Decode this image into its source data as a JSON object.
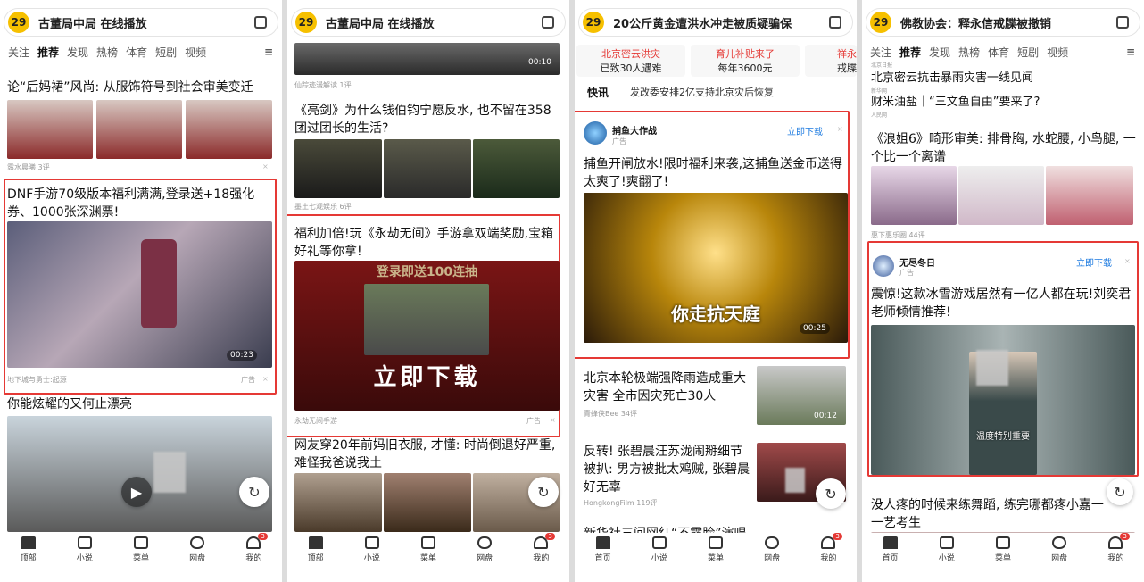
{
  "screens": [
    {
      "temp": "29",
      "hot": "古董局中局 在线播放",
      "tabs": [
        "关注",
        "推荐",
        "发现",
        "热榜",
        "体育",
        "短剧",
        "视频"
      ],
      "item1_title": "论“后妈裙”风尚: 从服饰符号到社会审美变迁",
      "item1_meta": "露水晨曦  3评",
      "ad_title": "DNF手游70级版本福利满满,登录送+18强化券、1000张深渊票!",
      "ad_source": "地下城与勇士:起源",
      "ad_label": "广告",
      "ad_duration": "00:23",
      "item3_title": "你能炫耀的又何止漂亮"
    },
    {
      "temp": "29",
      "hot": "古董局中局 在线播放",
      "top_duration": "00:10",
      "top_meta": "仙踪迹漫解读  1评",
      "item1_title": "《亮剑》为什么钱伯钧宁愿反水, 也不留在358团过团长的生活?",
      "item1_meta": "墨土七观娱乐  6评",
      "ad_title": "福利加倍!玩《永劫无间》手游拿双端奖励,宝箱好礼等你拿!",
      "ad_banner": "立即下载",
      "ad_top_text": "登录即送100连抽",
      "ad_source": "永劫无间手游",
      "ad_label": "广告",
      "item3_title": "网友穿20年前妈旧衣服, 才懂: 时尚倒退好严重, 难怪我爸说我土"
    },
    {
      "temp": "29",
      "hot": "20公斤黄金遭洪水冲走被质疑骗保",
      "cards": [
        {
          "a": "北京密云洪灾",
          "b": "已致30人遇难"
        },
        {
          "a": "育儿补贴来了",
          "b": "每年3600元"
        },
        {
          "a": "祥永",
          "b": "戒牒"
        }
      ],
      "flash_tag": "快讯",
      "flash_text": "发改委安排2亿支持北京灾后恢复",
      "ad_name": "捕鱼大作战",
      "ad_label": "广告",
      "ad_download": "立即下载",
      "ad_title": "捕鱼开闸放水!限时福利来袭,这捕鱼送金币送得太爽了!爽翻了!",
      "ad_banner": "你走抗天庭",
      "ad_duration": "00:25",
      "item2_title": "北京本轮极端强降雨造成重大灾害 全市因灾死亡30人",
      "item2_meta": "青蜂侠Bee  34评",
      "item2_duration": "00:12",
      "item3_title": "反转! 张碧晨汪苏泷闹掰细节被扒: 男方被批太鸡贼, 张碧晨好无辜",
      "item3_meta": "HongkongFilm  119评",
      "item4_title": "新华社三问网红“不露脸”演唱"
    },
    {
      "temp": "29",
      "hot": "佛教协会：释永信戒牒被撤销",
      "tabs": [
        "关注",
        "推荐",
        "发现",
        "热榜",
        "体育",
        "短剧",
        "视频"
      ],
      "item0_src": "北京日报",
      "item0_title": "北京密云抗击暴雨灾害一线见闻",
      "item1_src": "新华网",
      "item1_title": "财米油盐｜“三文鱼自由”要来了?",
      "item1_src2": "人民网",
      "item2_title": "《浪姐6》畸形审美: 排骨胸, 水蛇腰, 小鸟腿, 一个比一个离谱",
      "item2_meta": "惠下惠乐圈  44评",
      "ad_name": "无尽冬日",
      "ad_label": "广告",
      "ad_download": "立即下载",
      "ad_title": "震惊!这款冰雪游戏居然有一亿人都在玩!刘奕君老师倾情推荐!",
      "ad_caption": "温度特别重要",
      "item3_title": "没人疼的时候来练舞蹈, 练完哪都疼小嘉一一艺考生"
    }
  ],
  "nav": {
    "home": "首页",
    "home_alt": "顶部",
    "novel": "小说",
    "menu": "菜单",
    "cloud": "网盘",
    "mine": "我的",
    "badge": "3"
  }
}
